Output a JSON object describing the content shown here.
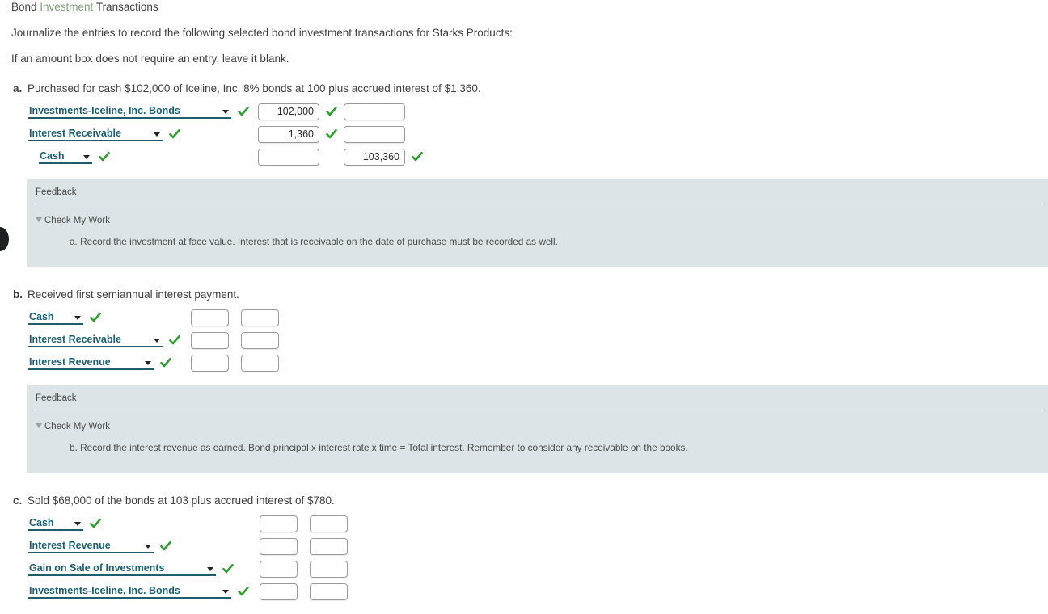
{
  "header": {
    "title_prefix": "Bond ",
    "title_accent": "Investment",
    "title_suffix": " Transactions",
    "intro_1": "Journalize the entries to record the following selected bond investment transactions for Starks Products:",
    "intro_2": "If an amount box does not require an entry, leave it blank."
  },
  "colors": {
    "accent_green": "#7f9e79",
    "check_green": "#2e9e2e",
    "link_teal": "#1b5f73",
    "feedback_bg": "#dde4e7",
    "text": "#3f3f3f"
  },
  "transactions": [
    {
      "label": "a.",
      "description": "Purchased for cash $102,000 of Iceline, Inc. 8% bonds at 100 plus accrued interest of $1,360.",
      "rows": [
        {
          "account": "Investments-Iceline, Inc. Bonds",
          "account_checked": "true",
          "debit": "102,000",
          "debit_checked": "true",
          "credit": "",
          "credit_checked": "false"
        },
        {
          "account": "Interest Receivable",
          "account_checked": "true",
          "debit": "1,360",
          "debit_checked": "true",
          "credit": "",
          "credit_checked": "false"
        },
        {
          "account": "Cash",
          "account_checked": "true",
          "debit": "",
          "debit_checked": "false",
          "credit": "103,360",
          "credit_checked": "true"
        }
      ],
      "feedback": {
        "title": "Feedback",
        "check_my_work": "Check My Work",
        "body": "a. Record the investment at face value. Interest that is receivable on the date of purchase must be recorded as well."
      }
    },
    {
      "label": "b.",
      "description": "Received first semiannual interest payment.",
      "rows": [
        {
          "account": "Cash",
          "account_checked": "true",
          "debit": "",
          "debit_checked": "false",
          "credit": "",
          "credit_checked": "false"
        },
        {
          "account": "Interest Receivable",
          "account_checked": "true",
          "debit": "",
          "debit_checked": "false",
          "credit": "",
          "credit_checked": "false"
        },
        {
          "account": "Interest Revenue",
          "account_checked": "true",
          "debit": "",
          "debit_checked": "false",
          "credit": "",
          "credit_checked": "false"
        }
      ],
      "feedback": {
        "title": "Feedback",
        "check_my_work": "Check My Work",
        "body": "b. Record the interest revenue as earned. Bond principal x interest rate x time = Total interest. Remember to consider any receivable on the books."
      }
    },
    {
      "label": "c.",
      "description": "Sold $68,000 of the bonds at 103 plus accrued interest of $780.",
      "rows": [
        {
          "account": "Cash",
          "account_checked": "true",
          "debit": "",
          "debit_checked": "false",
          "credit": "",
          "credit_checked": "false"
        },
        {
          "account": "Interest Revenue",
          "account_checked": "true",
          "debit": "",
          "debit_checked": "false",
          "credit": "",
          "credit_checked": "false"
        },
        {
          "account": "Gain on Sale of Investments",
          "account_checked": "true",
          "debit": "",
          "debit_checked": "false",
          "credit": "",
          "credit_checked": "false"
        },
        {
          "account": "Investments-Iceline, Inc. Bonds",
          "account_checked": "true",
          "debit": "",
          "debit_checked": "false",
          "credit": "",
          "credit_checked": "false"
        }
      ]
    }
  ]
}
